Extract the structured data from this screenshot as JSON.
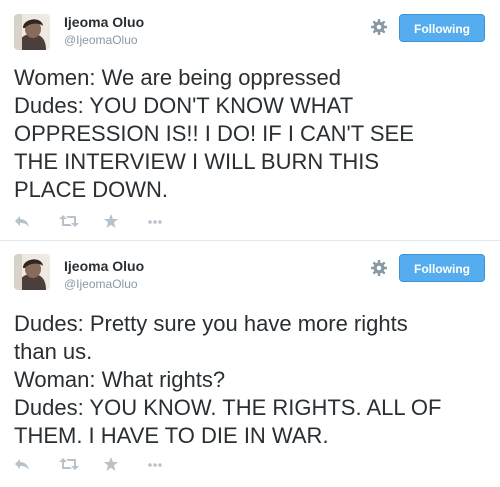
{
  "colors": {
    "text": "#292f33",
    "muted": "#8899a6",
    "follow_button": "#55acee",
    "action_icon": "#b8c2cb"
  },
  "tweets": [
    {
      "author_name": "Ijeoma Oluo",
      "author_handle": "@IjeomaOluo",
      "follow_label": "Following",
      "lines": [
        "Women: We are being oppressed",
        "Dudes: YOU DON'T KNOW WHAT",
        "OPPRESSION IS!! I DO! IF I CAN'T SEE",
        "THE INTERVIEW I WILL BURN THIS",
        "PLACE DOWN."
      ],
      "actions": [
        "reply-icon",
        "retweet-icon",
        "favorite-icon",
        "more-icon"
      ]
    },
    {
      "author_name": "Ijeoma Oluo",
      "author_handle": "@IjeomaOluo",
      "follow_label": "Following",
      "lines": [
        "Dudes: Pretty sure you have more rights",
        "than us.",
        "Woman: What rights?",
        "Dudes: YOU KNOW. THE RIGHTS. ALL OF",
        "THEM. I HAVE TO DIE IN WAR."
      ],
      "actions": [
        "reply-icon",
        "retweet-icon",
        "favorite-icon",
        "more-icon"
      ]
    }
  ]
}
